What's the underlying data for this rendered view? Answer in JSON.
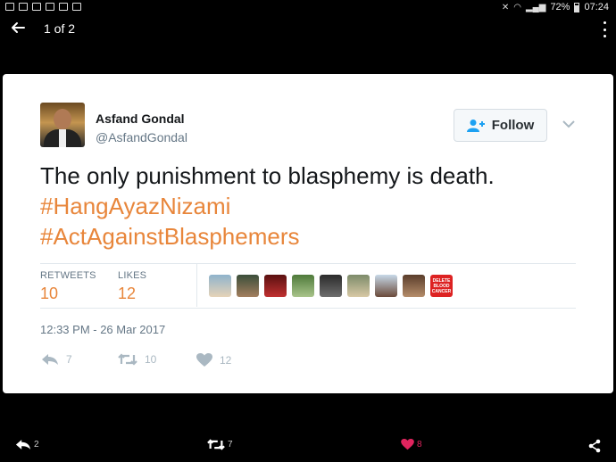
{
  "status_bar": {
    "battery": "72%",
    "time": "07:24"
  },
  "app_bar": {
    "pager": "1 of 2"
  },
  "tweet": {
    "author_name": "Asfand Gondal",
    "author_handle": "@AsfandGondal",
    "follow_label": "Follow",
    "text_line": "The only punishment to blasphemy is death.",
    "hashtags": [
      "#HangAyazNizami",
      "#ActAgainstBlasphemers"
    ],
    "retweets_label": "RETWEETS",
    "retweets_count": "10",
    "likes_label": "LIKES",
    "likes_count": "12",
    "liker_avatars": [
      "avatar-1",
      "avatar-2",
      "avatar-3",
      "avatar-4",
      "avatar-5",
      "avatar-6",
      "avatar-7",
      "avatar-8",
      "avatar-9"
    ],
    "liker_badge_text": "DELETE BLOOD CANCER",
    "timestamp": "12:33 PM - 26 Mar 2017",
    "actions": {
      "reply_count": "7",
      "retweet_count": "10",
      "like_count": "12"
    }
  },
  "bottom_bar": {
    "reply_count": "2",
    "retweet_count": "7",
    "like_count": "8"
  },
  "colors": {
    "accent": "#e8863b",
    "like_pink": "#e0245e",
    "background": "#000000",
    "card": "#ffffff"
  },
  "icons": [
    "arrow-back-icon",
    "more-vert-icon",
    "follow-user-icon",
    "chevron-down-icon",
    "reply-icon",
    "retweet-icon",
    "heart-icon",
    "share-icon"
  ]
}
